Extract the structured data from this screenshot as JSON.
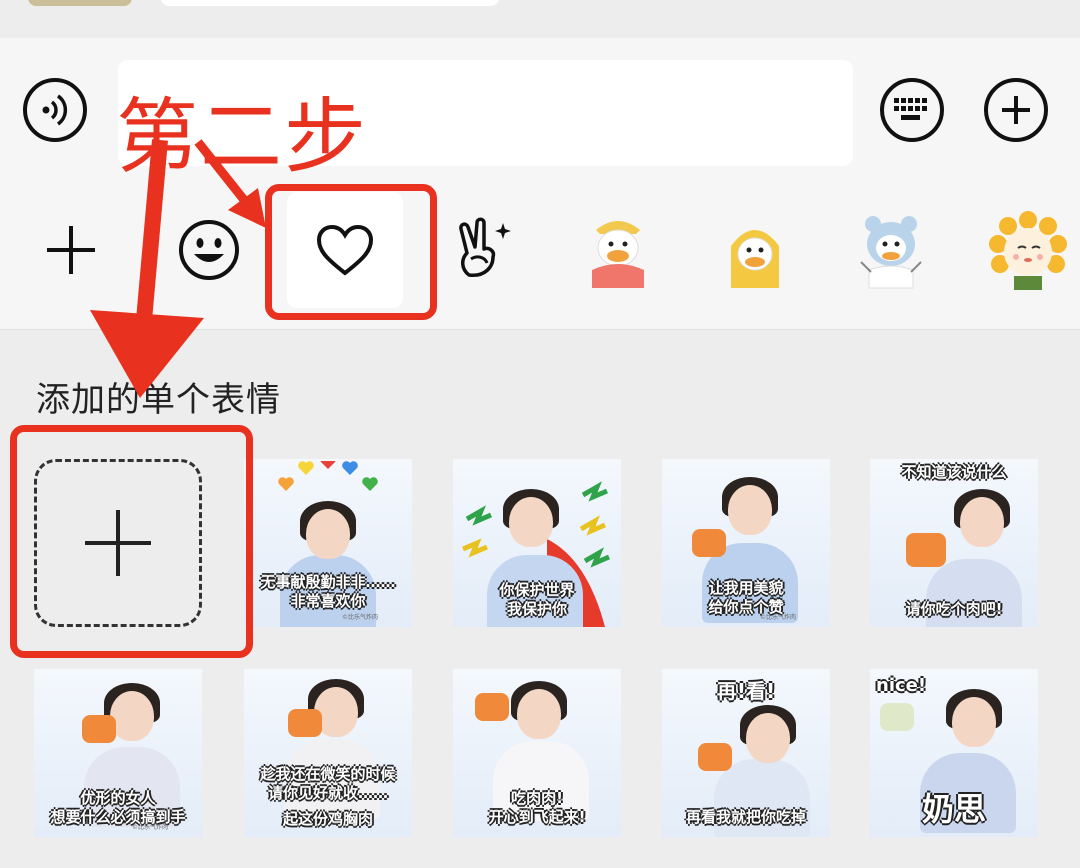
{
  "input_bar": {
    "voice_icon": "voice-wave-icon",
    "keyboard_icon": "keyboard-icon",
    "more_icon": "plus-circle-icon",
    "text_value": ""
  },
  "emoji_tabs": [
    {
      "name": "add",
      "icon": "plus-icon"
    },
    {
      "name": "emoji",
      "icon": "smiley-icon"
    },
    {
      "name": "favorites",
      "icon": "heart-icon",
      "selected": true
    },
    {
      "name": "gestures",
      "icon": "victory-hand-icon"
    },
    {
      "name": "duck-pack-1",
      "icon": "duck-red-sticker-icon"
    },
    {
      "name": "duck-pack-2",
      "icon": "duck-yellow-sticker-icon"
    },
    {
      "name": "duck-pack-3",
      "icon": "duck-hoodie-sticker-icon"
    },
    {
      "name": "sun-pack",
      "icon": "sunflower-sticker-icon"
    }
  ],
  "panel": {
    "section_title": "添加的单个表情",
    "add_icon": "plus-icon"
  },
  "stickers": [
    {
      "caption": "无事献殷勤非非……\n非常喜欢你",
      "caption_pos": "bottom",
      "watermark": "©比乐气炸肉"
    },
    {
      "caption": "你保护世界\n我保护你",
      "caption_pos": "bottom",
      "watermark": "©比乐气炸肉"
    },
    {
      "caption": "让我用美貌\n给你点个赞",
      "caption_pos": "bottom",
      "watermark": "©比乐气炸肉"
    },
    {
      "caption": "不知道该说什么",
      "caption_pos": "top",
      "caption2": "请你吃个肉吧!",
      "watermark": ""
    },
    {
      "caption": "优形的女人\n想要什么必须搞到手",
      "caption_pos": "bottom",
      "watermark": "©比乐气炸肉"
    },
    {
      "caption": "趁我还在微笑的时候\n请你见好就收……",
      "caption_pos": "bottom",
      "caption2": "起这份鸡胸肉",
      "watermark": ""
    },
    {
      "caption": "吃肉肉!\n开心到飞起来!",
      "caption_pos": "bottom",
      "watermark": ""
    },
    {
      "caption": "再!看!",
      "caption_pos": "top",
      "caption2": "再看我就把你吃掉",
      "watermark": ""
    },
    {
      "caption": "nice!",
      "caption_pos": "top",
      "caption2": "奶思",
      "watermark": ""
    }
  ],
  "annotation": {
    "label": "第二步",
    "color": "#e8321f"
  }
}
